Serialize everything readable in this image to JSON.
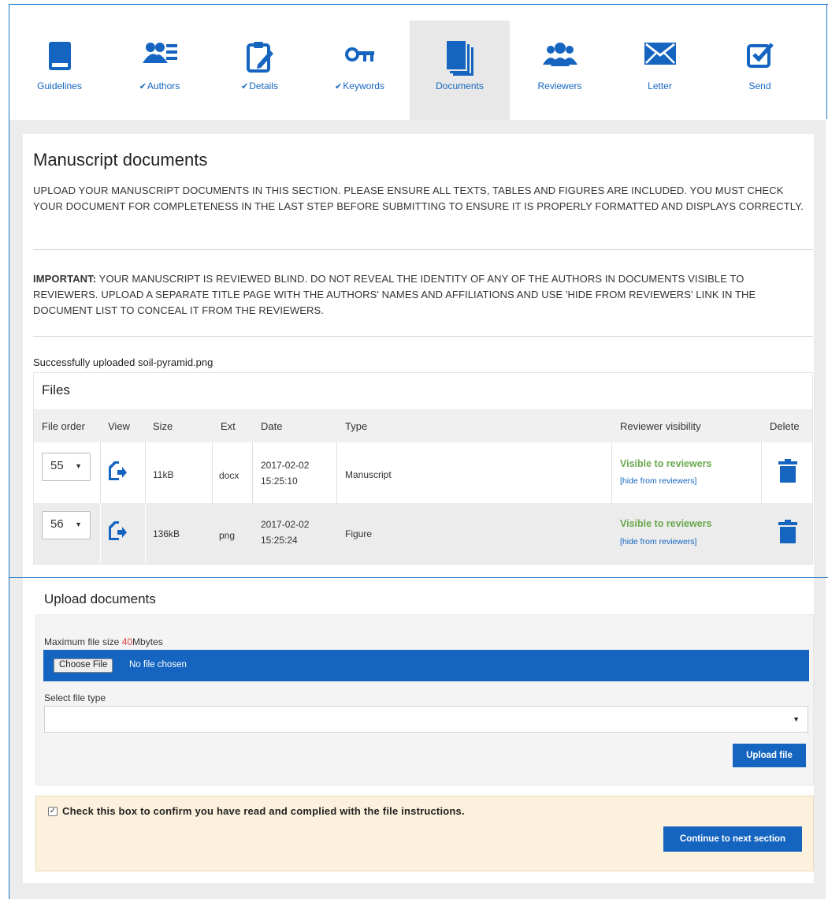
{
  "nav": {
    "tabs": [
      {
        "label": "Guidelines",
        "icon": "book-icon",
        "checked": false,
        "active": false
      },
      {
        "label": "Authors",
        "icon": "authors-list-icon",
        "checked": true,
        "active": false
      },
      {
        "label": "Details",
        "icon": "clipboard-edit-icon",
        "checked": true,
        "active": false
      },
      {
        "label": "Keywords",
        "icon": "key-icon",
        "checked": true,
        "active": false
      },
      {
        "label": "Documents",
        "icon": "documents-icon",
        "checked": false,
        "active": true
      },
      {
        "label": "Reviewers",
        "icon": "users-icon",
        "checked": false,
        "active": false
      },
      {
        "label": "Letter",
        "icon": "envelope-icon",
        "checked": false,
        "active": false
      },
      {
        "label": "Send",
        "icon": "check-square-icon",
        "checked": false,
        "active": false
      }
    ],
    "check_mark": "✔"
  },
  "page": {
    "title": "Manuscript documents",
    "instructions": "UPLOAD YOUR MANUSCRIPT DOCUMENTS IN THIS SECTION. PLEASE ENSURE ALL TEXTS, TABLES AND FIGURES ARE INCLUDED. YOU MUST CHECK YOUR DOCUMENT FOR COMPLETENESS IN THE LAST STEP BEFORE SUBMITTING TO ENSURE IT IS PROPERLY FORMATTED AND DISPLAYS CORRECTLY.",
    "important_label": "IMPORTANT:",
    "important_text": " YOUR MANUSCRIPT IS REVIEWED BLIND. DO NOT REVEAL THE IDENTITY OF ANY OF THE AUTHORS IN DOCUMENTS VISIBLE TO REVIEWERS. UPLOAD A SEPARATE TITLE PAGE WITH THE AUTHORS' NAMES AND AFFILIATIONS AND USE 'HIDE FROM REVIEWERS' LINK IN THE DOCUMENT LIST TO CONCEAL IT FROM THE REVIEWERS.",
    "success_message": "Successfully uploaded soil-pyramid.png"
  },
  "files": {
    "title": "Files",
    "columns": {
      "order": "File order",
      "view": "View",
      "size": "Size",
      "ext": "Ext",
      "date": "Date",
      "type": "Type",
      "visibility": "Reviewer visibility",
      "delete": "Delete"
    },
    "rows": [
      {
        "order": "55",
        "size": "11kB",
        "ext": "docx",
        "date": "2017-02-02",
        "time": "15:25:10",
        "type": "Manuscript",
        "visibility": "Visible to reviewers",
        "hide_link": "[hide from reviewers]"
      },
      {
        "order": "56",
        "size": "136kB",
        "ext": "png",
        "date": "2017-02-02",
        "time": "15:25:24",
        "type": "Figure",
        "visibility": "Visible to reviewers",
        "hide_link": "[hide from reviewers]"
      }
    ]
  },
  "upload": {
    "title": "Upload documents",
    "max_size_prefix": "Maximum file size ",
    "max_size_value": "40",
    "max_size_unit": "Mbytes",
    "choose_file_label": "Choose File",
    "no_file_text": "No file chosen",
    "select_type_label": "Select file type",
    "select_type_value": "",
    "upload_button": "Upload file"
  },
  "confirm": {
    "checked": true,
    "text": "Check this box to confirm you have read and complied with the file instructions.",
    "continue_button": "Continue to next section"
  },
  "colors": {
    "accent": "#1565c0",
    "visible_green": "#6aa84f",
    "confirm_bg": "#fcf1dc",
    "size_red": "#e0383e"
  }
}
